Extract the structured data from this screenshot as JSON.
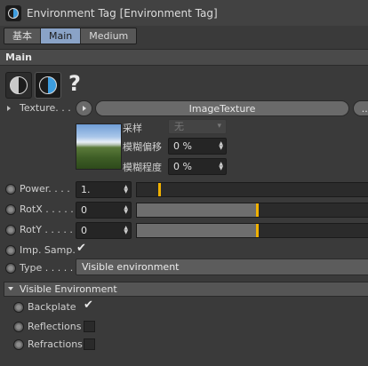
{
  "window": {
    "title": "Environment Tag [Environment Tag]"
  },
  "tabs": [
    "基本",
    "Main",
    "Medium"
  ],
  "section": {
    "title": "Main"
  },
  "texture": {
    "label": "Texture. . .",
    "button_label": "ImageTexture",
    "sampling_label": "采样",
    "sampling_value": "无",
    "blur_offset_label": "模糊偏移",
    "blur_offset_value": "0 %",
    "blur_scale_label": "模糊程度",
    "blur_scale_value": "0 %"
  },
  "power": {
    "label": "Power. . . .",
    "value": "1.",
    "fraction": 0.1
  },
  "rotx": {
    "label": "RotX . . . . .",
    "value": "0",
    "fraction": 0.5
  },
  "roty": {
    "label": "RotY . . . . .",
    "value": "0",
    "fraction": 0.5
  },
  "imp_samp": {
    "label": "Imp. Samp.",
    "checked": true
  },
  "type": {
    "label": "Type . . . . .",
    "value": "Visible environment"
  },
  "visible_env": {
    "title": "Visible Environment",
    "items": [
      {
        "label": "Backplate",
        "checked": true
      },
      {
        "label": "Reflections",
        "checked": false
      },
      {
        "label": "Refractions",
        "checked": false
      }
    ]
  }
}
